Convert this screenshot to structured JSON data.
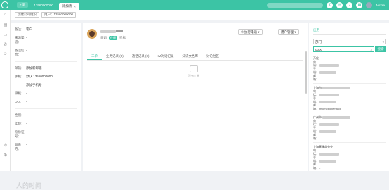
{
  "topbar": {
    "new_label": "+ 新",
    "tabs": [
      {
        "label": "13560000000",
        "active": false
      },
      {
        "label": "添加待",
        "active": true
      }
    ],
    "user_name": "Nicole",
    "accent": "#3cc4a5"
  },
  "leftnav": {
    "icons": [
      "home-icon",
      "grid-icon",
      "chat-icon",
      "phone-icon",
      "user-icon",
      "settings-icon",
      "add-icon"
    ]
  },
  "crumbs": [
    "创建公司组织",
    "用户：13560000000"
  ],
  "left_fields": [
    {
      "k": "备注：",
      "v": "客户"
    },
    {
      "k": "来源渠道：",
      "v": "-"
    },
    {
      "k": "备注信息：",
      "v": "-"
    },
    {
      "k": "邮箱：",
      "v": "添加新邮箱",
      "link": true
    },
    {
      "k": "手机：",
      "v": "默认 13560000000"
    },
    {
      "k": "",
      "v": "添加手机号",
      "link": true
    },
    {
      "k": "微机：",
      "v": "-"
    },
    {
      "k": "QQ：",
      "v": "-"
    },
    {
      "k": "性别：",
      "v": "-"
    },
    {
      "k": "年龄：",
      "v": "-"
    },
    {
      "k": "身份证号：",
      "v": "-"
    },
    {
      "k": "联系方：",
      "v": "-"
    }
  ],
  "profile": {
    "name_suffix": "0000",
    "status_label": "状态",
    "status_badge": "在线",
    "tag_label": "星标",
    "dropdown1": "执行电话",
    "dropdown2": "用户管理"
  },
  "center_tabs": [
    "工单",
    "业务记录 (0)",
    "通话记录 (0)",
    "IM对话记录",
    "知识文档库",
    "讨论社区"
  ],
  "empty_text": "没有工单",
  "right": {
    "tab": "应用",
    "select_value": "部门",
    "search_value": "0000",
    "search_button": "搜索",
    "items": [
      {
        "name": "万位",
        "lines": [
          "电话：",
          "手机：",
          "邮箱："
        ],
        "email": "-"
      },
      {
        "name": "上海市",
        "lines": [
          "电话：",
          "手机：",
          "邮箱："
        ],
        "email": "mikm@dnema.ck"
      },
      {
        "name": "广州市",
        "lines": [
          "电话：",
          "手机：",
          "邮箱："
        ],
        "email": "-"
      },
      {
        "name": "上海客服部分业",
        "lines": [
          "电话：",
          "手机：",
          "邮箱："
        ],
        "email": "-"
      }
    ]
  },
  "watermark": "人的时间"
}
